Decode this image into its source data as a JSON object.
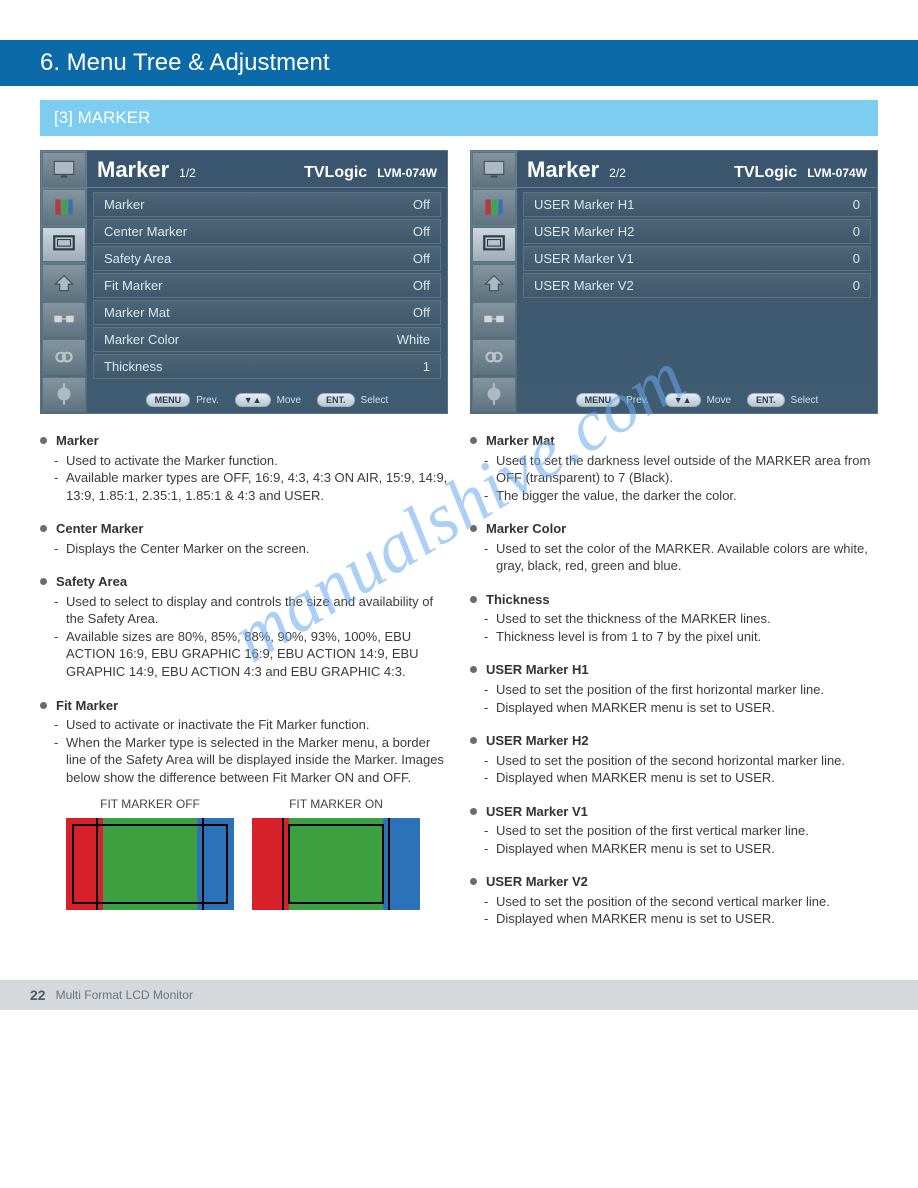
{
  "banner": {
    "title": "6. Menu Tree & Adjustment"
  },
  "section": {
    "title": "[3] MARKER"
  },
  "osd_left": {
    "title": "Marker",
    "page": "1/2",
    "brand": "TVLogic",
    "model": "LVM-074W",
    "rows": [
      {
        "label": "Marker",
        "value": "Off"
      },
      {
        "label": "Center Marker",
        "value": "Off"
      },
      {
        "label": "Safety Area",
        "value": "Off"
      },
      {
        "label": "Fit Marker",
        "value": "Off"
      },
      {
        "label": "Marker Mat",
        "value": "Off"
      },
      {
        "label": "Marker Color",
        "value": "White"
      },
      {
        "label": "Thickness",
        "value": "1"
      }
    ],
    "hint_prev": "MENU",
    "hint_prev_t": "Prev.",
    "hint_move": "▼▲",
    "hint_move_t": "Move",
    "hint_sel": "ENT.",
    "hint_sel_t": "Select"
  },
  "osd_right": {
    "title": "Marker",
    "page": "2/2",
    "brand": "TVLogic",
    "model": "LVM-074W",
    "rows": [
      {
        "label": "USER Marker H1",
        "value": "0"
      },
      {
        "label": "USER Marker H2",
        "value": "0"
      },
      {
        "label": "USER Marker V1",
        "value": "0"
      },
      {
        "label": "USER Marker V2",
        "value": "0"
      }
    ],
    "hint_prev": "MENU",
    "hint_prev_t": "Prev.",
    "hint_move": "▼▲",
    "hint_move_t": "Move",
    "hint_sel": "ENT.",
    "hint_sel_t": "Select"
  },
  "left_items": {
    "0": {
      "title": "Marker",
      "subs": [
        "Used to activate the Marker function.",
        "Available marker types are OFF, 16:9, 4:3, 4:3 ON AIR, 15:9, 14:9, 13:9, 1.85:1, 2.35:1, 1.85:1 & 4:3 and USER."
      ]
    },
    "1": {
      "title": "Center Marker",
      "subs": [
        "Displays the Center Marker on the screen."
      ]
    },
    "2": {
      "title": "Safety Area",
      "subs": [
        "Used to select to display and controls the size and availability of the Safety Area.",
        "Available sizes are 80%, 85%, 88%, 90%, 93%, 100%, EBU ACTION 16:9, EBU GRAPHIC 16:9, EBU ACTION 14:9, EBU GRAPHIC 14:9, EBU ACTION 4:3 and EBU GRAPHIC 4:3."
      ]
    },
    "3": {
      "title": "Fit Marker",
      "subs": [
        "Used to activate or inactivate the Fit Marker function.",
        "When the Marker type is selected in the Marker menu, a border line of the Safety Area will be displayed inside the Marker. Images below show the difference between Fit Marker ON and OFF."
      ]
    },
    "fit": {
      "off": "FIT MARKER OFF",
      "on": "FIT MARKER ON"
    }
  },
  "right_items": {
    "0": {
      "title": "Marker Mat",
      "subs": [
        "Used to set the darkness level outside of the MARKER area from OFF (transparent) to 7 (Black).",
        "The bigger the value, the darker the color."
      ]
    },
    "1": {
      "title": "Marker Color",
      "subs": [
        "Used to set the color of the MARKER. Available colors are white, gray, black, red, green and blue."
      ]
    },
    "2": {
      "title": "Thickness",
      "subs": [
        "Used to set the thickness of the MARKER lines.",
        "Thickness level is from 1 to 7 by the pixel unit."
      ]
    },
    "3": {
      "title": "USER Marker H1",
      "subs": [
        "Used to set the position of the first horizontal marker line.",
        "Displayed when MARKER menu is set to USER."
      ]
    },
    "4": {
      "title": "USER Marker H2",
      "subs": [
        "Used to set the position of the second horizontal marker line.",
        "Displayed when MARKER menu is set to USER."
      ]
    },
    "5": {
      "title": "USER Marker V1",
      "subs": [
        "Used to set the position of the first vertical marker line.",
        "Displayed when MARKER menu is set to USER."
      ]
    },
    "6": {
      "title": "USER Marker V2",
      "subs": [
        "Used to set the position of the second vertical marker line.",
        "Displayed when MARKER menu is set to USER."
      ]
    }
  },
  "footer": {
    "page": "22",
    "text": "Multi Format LCD Monitor"
  },
  "watermark": "manualshive.com"
}
